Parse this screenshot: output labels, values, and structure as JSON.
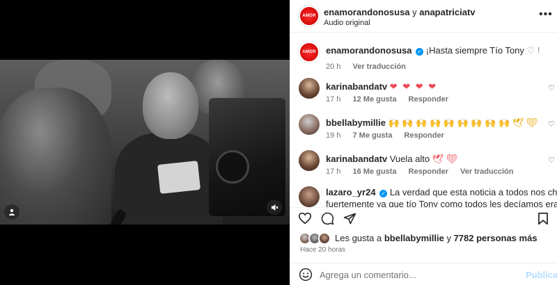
{
  "header": {
    "user1": "enamorandonosusa",
    "joiner": "y",
    "user2": "anapatriciatv",
    "audio": "Audio original",
    "more_icon": "more-horizontal-icon"
  },
  "brand_avatar_text": "AMOR",
  "comments": [
    {
      "user": "enamorandonosusa",
      "verified": true,
      "text": "¡Hasta siempre Tío Tony",
      "text_suffix": "♡ !",
      "time": "20 h",
      "likes": "",
      "reply": "",
      "translate": "Ver traducción"
    },
    {
      "user": "karinabandatv",
      "verified": false,
      "text": "❤ ❤ ❤ ❤",
      "time": "17 h",
      "likes": "12 Me gusta",
      "reply": "Responder",
      "translate": ""
    },
    {
      "user": "bbellabymillie",
      "verified": false,
      "text": "🙌 🙌 🙌 🙌 🙌 🙌 🙌 🙌 🙌 🕊 ❤",
      "time": "19 h",
      "likes": "7 Me gusta",
      "reply": "Responder",
      "translate": ""
    },
    {
      "user": "karinabandatv",
      "verified": false,
      "text": "Vuela alto",
      "text_suffix": "🕊 ❤",
      "time": "17 h",
      "likes": "16 Me gusta",
      "reply": "Responder",
      "translate": "Ver traducción"
    },
    {
      "user": "lazaro_yr24",
      "verified": true,
      "text": "La verdad que esta noticia a todos nos chocó",
      "text_line2": "fuertemente ya que tío Tony como todos les decíamos era una",
      "time": "",
      "likes": "",
      "reply": "",
      "translate": ""
    }
  ],
  "likes_line": {
    "prefix": "Les gusta a",
    "user": "bbellabymillie",
    "joiner": "y",
    "count": "7782 personas más"
  },
  "time_ago": "Hace 20 horas",
  "compose": {
    "placeholder": "Agrega un comentario...",
    "post_label": "Publicar"
  },
  "colors": {
    "accent_blue": "#0095f6",
    "heart_red": "#ed4956",
    "post_disabled": "#b3dbff",
    "brand_red": "#e01010"
  }
}
